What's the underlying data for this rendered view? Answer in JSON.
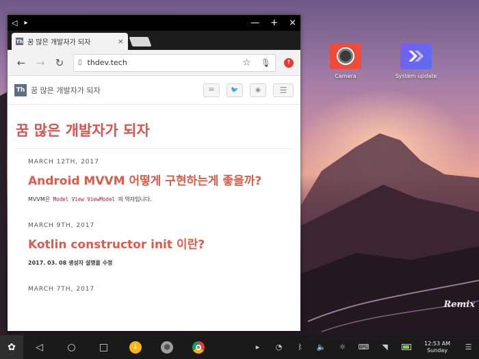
{
  "window": {
    "controls": {
      "back": "◁",
      "restore": "▸",
      "minimize": "—",
      "maximize": "+",
      "close": "×"
    }
  },
  "browser": {
    "tab_title": "꿈 많은 개발자가 되자",
    "tab_close": "×",
    "url": "thdev.tech",
    "logo_text": "Th"
  },
  "site": {
    "name": "꿈 많은 개발자가 되자",
    "hero_title": "꿈 많은 개발자가 되자",
    "posts": [
      {
        "date": "MARCH 12TH, 2017",
        "title": "Android MVVM 어떻게 구현하는게 좋을까?",
        "excerpt_prefix": "MVVM은",
        "excerpt_code": "Model View ViewModel",
        "excerpt_suffix": "의 약자입니다."
      },
      {
        "date": "MARCH 9TH, 2017",
        "title": "Kotlin constructor init 이란?",
        "excerpt": "2017. 03. 08 생성자 설명을 수정"
      },
      {
        "date": "MARCH 7TH, 2017"
      }
    ]
  },
  "desktop": {
    "icons": [
      {
        "label": "Camera"
      },
      {
        "label": "System update"
      }
    ],
    "watermark": "Remix"
  },
  "taskbar": {
    "start_label": "✿",
    "time": "12:53 AM",
    "day": "Sunday"
  }
}
